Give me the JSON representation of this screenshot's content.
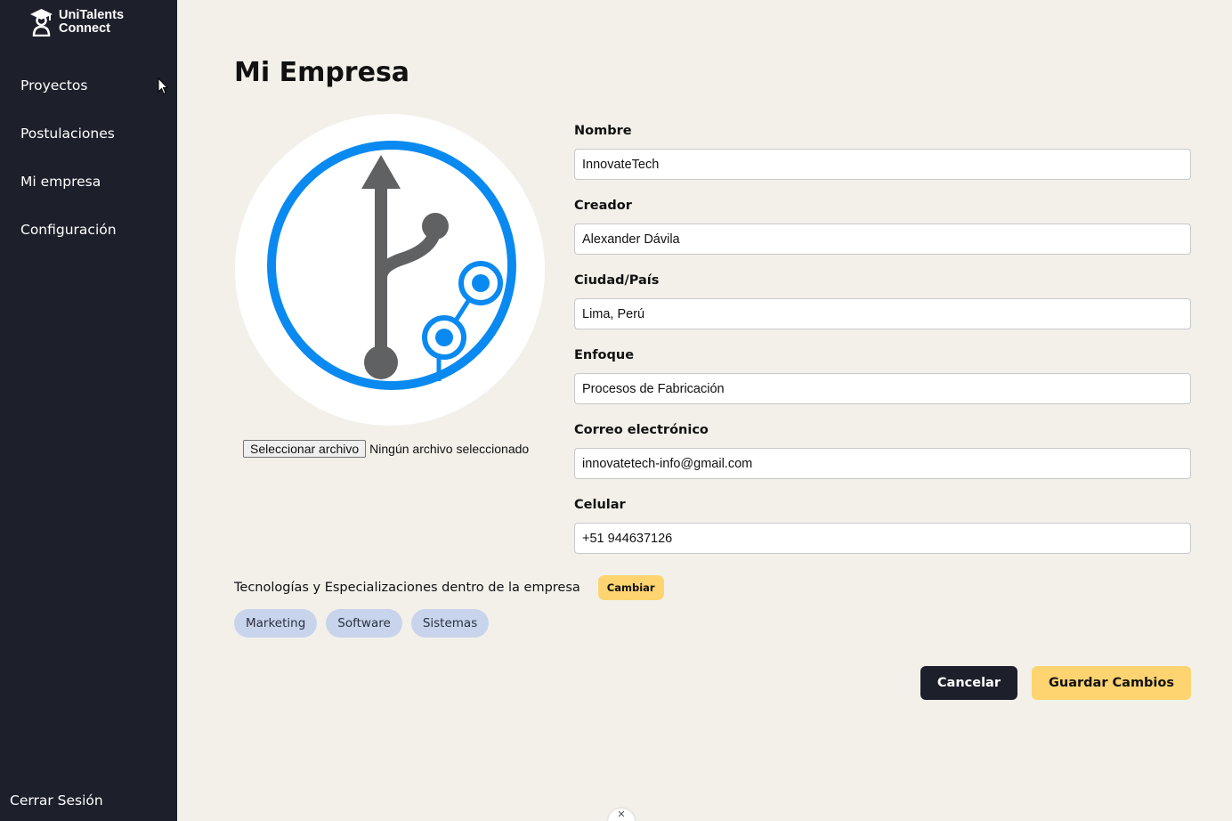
{
  "app": {
    "brand_line1": "UniTalents",
    "brand_line2": "Connect"
  },
  "sidebar": {
    "items": [
      {
        "label": "Proyectos"
      },
      {
        "label": "Postulaciones"
      },
      {
        "label": "Mi empresa"
      },
      {
        "label": "Configuración"
      }
    ],
    "logout_label": "Cerrar Sesión"
  },
  "page": {
    "title": "Mi Empresa"
  },
  "file_upload": {
    "button_label": "Seleccionar archivo",
    "status_text": "Ningún archivo seleccionado"
  },
  "form": {
    "fields": [
      {
        "label": "Nombre",
        "value": "InnovateTech"
      },
      {
        "label": "Creador",
        "value": "Alexander Dávila"
      },
      {
        "label": "Ciudad/País",
        "value": "Lima, Perú"
      },
      {
        "label": "Enfoque",
        "value": "Procesos de Fabricación"
      },
      {
        "label": "Correo electrónico",
        "value": "innovatetech-info@gmail.com"
      },
      {
        "label": "Celular",
        "value": "+51 944637126"
      }
    ]
  },
  "technologies": {
    "title": "Tecnologías y Especializaciones dentro de la empresa",
    "change_label": "Cambiar",
    "tags": [
      "Marketing",
      "Software",
      "Sistemas"
    ]
  },
  "actions": {
    "cancel_label": "Cancelar",
    "save_label": "Guardar Cambios"
  },
  "colors": {
    "sidebar_bg": "#1d1f2b",
    "page_bg": "#f3f0ea",
    "accent_yellow": "#fed471",
    "tag_bg": "#c8d4ec",
    "logo_blue": "#0a8af0",
    "logo_gray": "#5f6163"
  },
  "icons": {
    "brand": "graduate-person-icon",
    "company_logo": "git-branch-logo",
    "cursor": "mouse-pointer-icon",
    "bottom": "close-icon"
  }
}
